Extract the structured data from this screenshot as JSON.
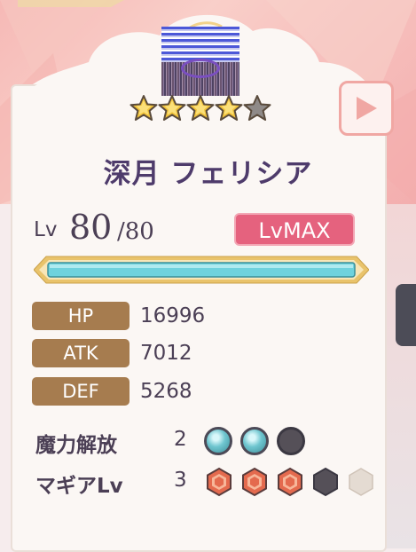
{
  "character": {
    "name": "深月 フェリシア",
    "stars_filled": 4,
    "stars_total": 5
  },
  "level": {
    "label": "Lv",
    "current": "80",
    "max": "/80",
    "badge": "LvMAX",
    "exp_fill_fraction": 1.0
  },
  "stats": [
    {
      "label": "HP",
      "value": "16996"
    },
    {
      "label": "ATK",
      "value": "7012"
    },
    {
      "label": "DEF",
      "value": "5268"
    }
  ],
  "awakening": {
    "label": "魔力解放",
    "count": "2",
    "filled": 2,
    "total": 3
  },
  "magia": {
    "label": "マギアLv",
    "count": "3",
    "filled": 3,
    "locked": 1,
    "total": 5
  },
  "colors": {
    "accent_pink": "#e5627e",
    "stat_badge": "#a67c4f",
    "exp_bar": "#6fd2dd",
    "star_gold": "#f2c33a"
  },
  "icons": {
    "play": "play-icon",
    "star": "star-icon",
    "orb": "magic-orb-icon",
    "magia_gem": "hex-gem-icon"
  }
}
